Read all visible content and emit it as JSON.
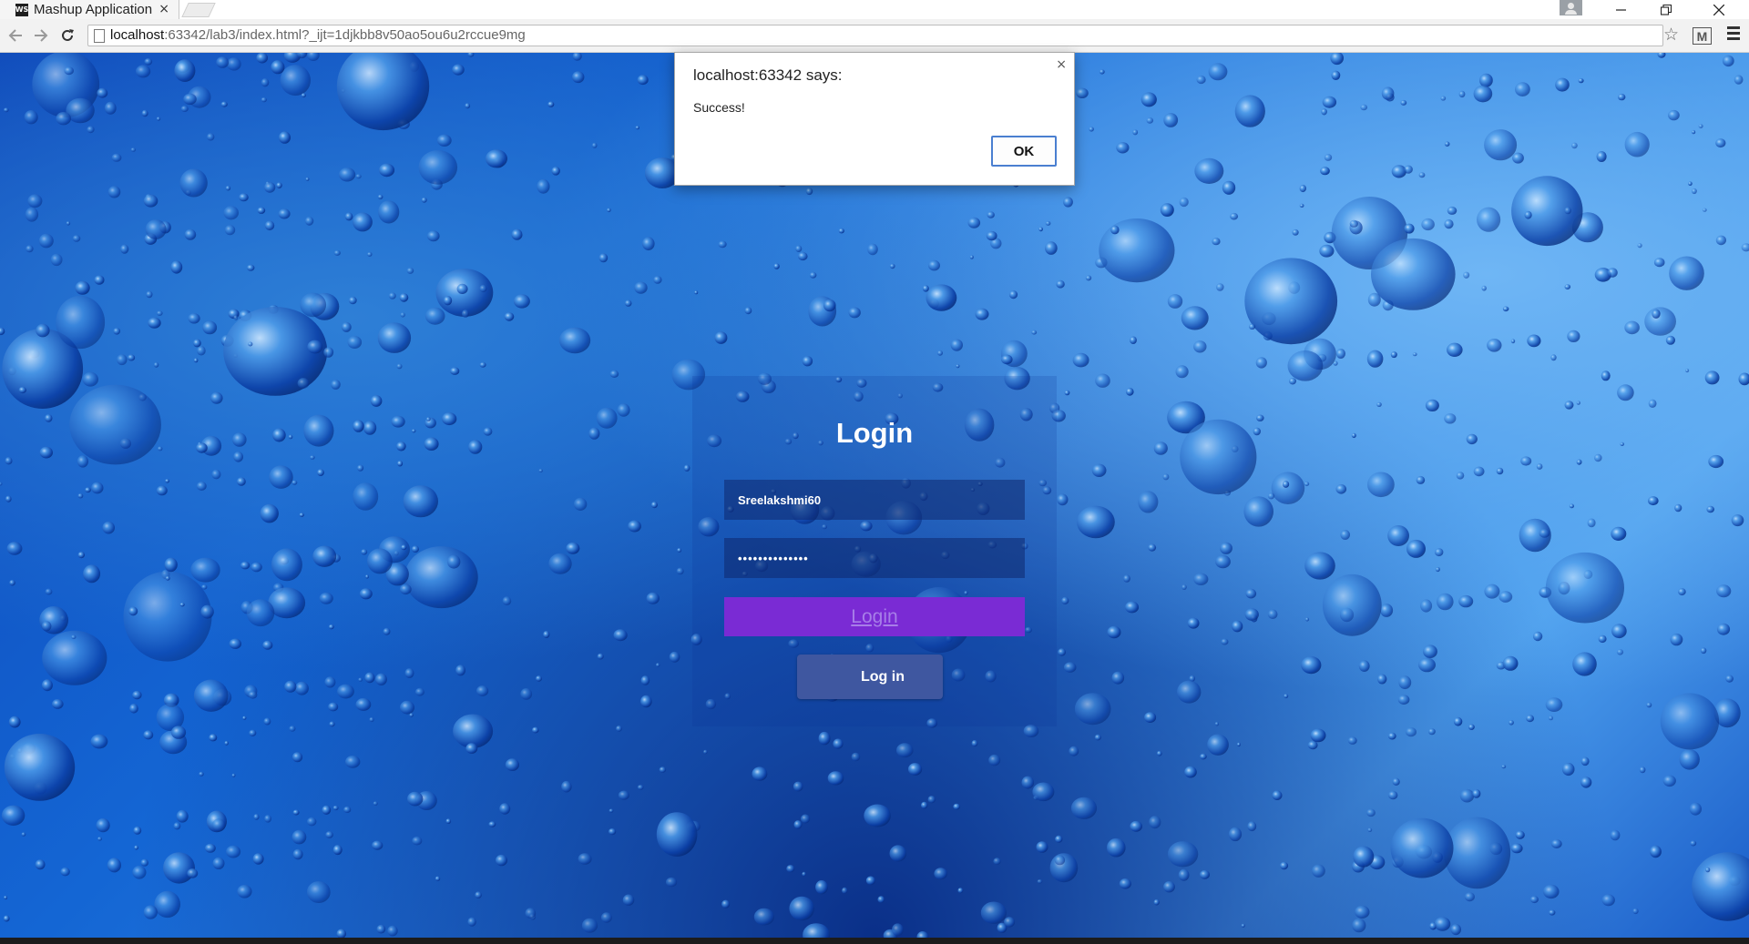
{
  "browser": {
    "tab_title": "Mashup Application",
    "tab_close_icon": "×",
    "favicon_text": "WS",
    "url_host": "localhost",
    "url_path": ":63342/lab3/index.html?_ijt=1djkbb8v50ao5ou6u2rccue9mg"
  },
  "login": {
    "title": "Login",
    "username_value": "Sreelakshmi60",
    "password_mask": "••••••••••••••",
    "primary_button_label": "Login",
    "facebook_button_label": "Log in"
  },
  "alert": {
    "title": "localhost:63342 says:",
    "message": "Success!",
    "ok_label": "OK",
    "close_icon": "×"
  },
  "colors": {
    "login_button": "#7a2bd4",
    "facebook_button": "#3f57a0",
    "dialog_ok_border": "#4a7fd0"
  }
}
